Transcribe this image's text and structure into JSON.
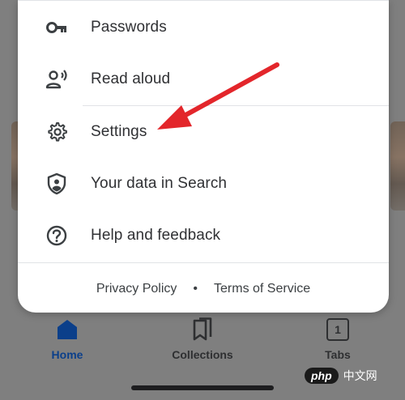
{
  "menu": {
    "items": [
      {
        "label": "Passwords",
        "icon": "key-icon"
      },
      {
        "label": "Read aloud",
        "icon": "person-speaking-icon"
      },
      {
        "label": "Settings",
        "icon": "gear-icon"
      },
      {
        "label": "Your data in Search",
        "icon": "shield-user-icon"
      },
      {
        "label": "Help and feedback",
        "icon": "help-circle-icon"
      }
    ]
  },
  "footer": {
    "privacy": "Privacy Policy",
    "separator": "•",
    "terms": "Terms of Service"
  },
  "bottom_nav": {
    "home": "Home",
    "collections": "Collections",
    "tabs": "Tabs",
    "tab_count": "1"
  },
  "watermark": {
    "brand": "php",
    "site": "中文网"
  },
  "colors": {
    "accent": "#0b3f8a",
    "arrow": "#e3262b"
  }
}
